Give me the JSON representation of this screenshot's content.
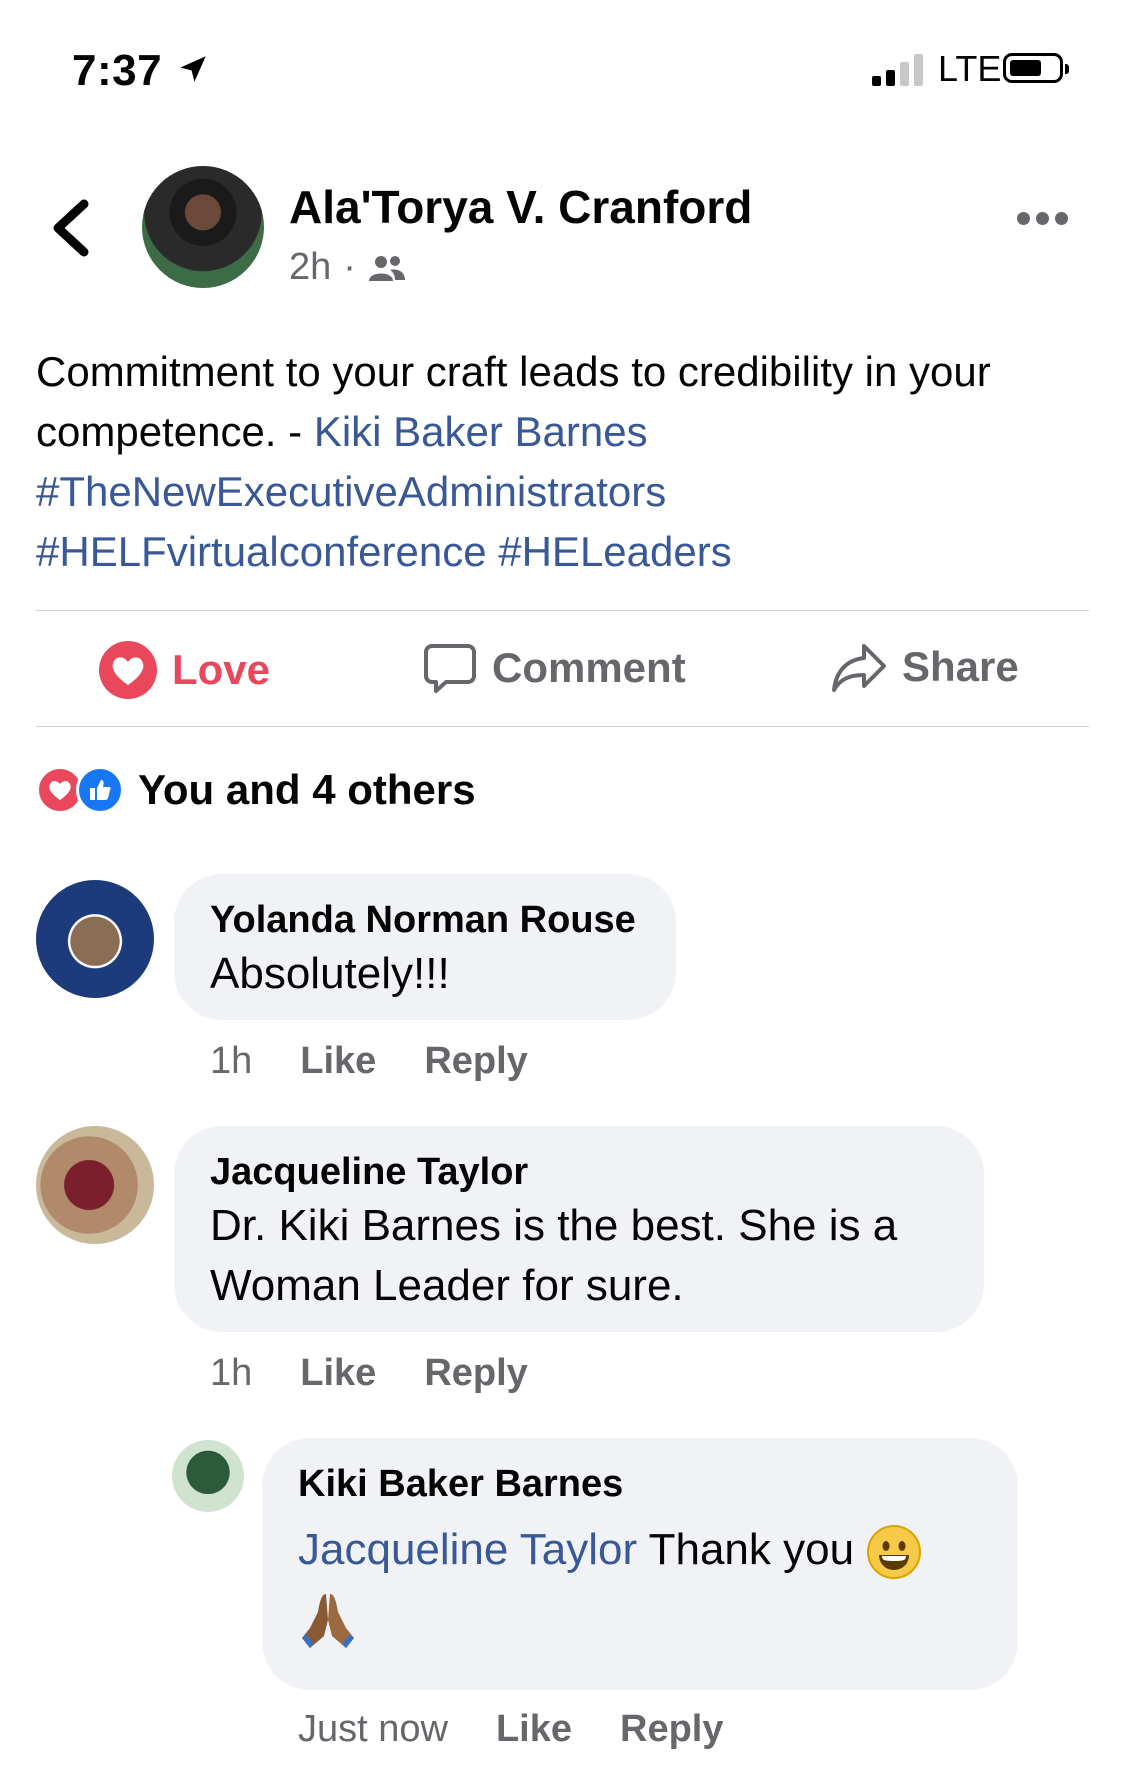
{
  "status_bar": {
    "time": "7:37",
    "network": "LTE"
  },
  "post": {
    "author": "Ala'Torya V. Cranford",
    "time": "2h",
    "audience_icon": "friends-icon",
    "text_before_link": "Commitment to your craft leads to credibility in your competence. - ",
    "link_name": "Kiki Baker Barnes",
    "hashtag_1": "#TheNewExecutiveAdministrators",
    "hashtag_2": "#HELFvirtualconference",
    "hashtag_3": "#HELeaders"
  },
  "actions": {
    "love": "Love",
    "comment": "Comment",
    "share": "Share"
  },
  "reactions": {
    "summary": "You and 4 others"
  },
  "comments": [
    {
      "name": "Yolanda Norman Rouse",
      "text": "Absolutely!!!",
      "time": "1h",
      "like": "Like",
      "reply": "Reply"
    },
    {
      "name": "Jacqueline Taylor",
      "text": "Dr. Kiki Barnes is the best. She is a Woman Leader for sure.",
      "time": "1h",
      "like": "Like",
      "reply": "Reply"
    }
  ],
  "reply": {
    "name": "Kiki Baker Barnes",
    "mention": "Jacqueline Taylor",
    "text": " Thank you",
    "time": "Just now",
    "like": "Like",
    "reply": "Reply"
  },
  "colors": {
    "link": "#385898",
    "love": "#e9475b",
    "like": "#1877f2",
    "bubble": "#f0f2f5",
    "muted": "#65676b"
  }
}
